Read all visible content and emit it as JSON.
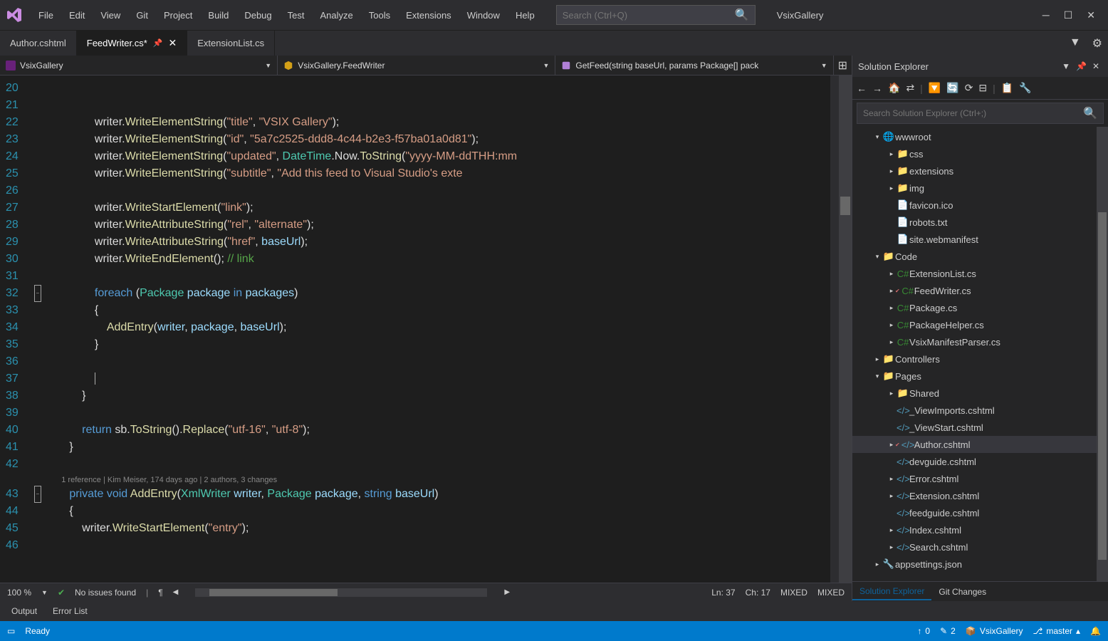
{
  "menu": [
    "File",
    "Edit",
    "View",
    "Git",
    "Project",
    "Build",
    "Debug",
    "Test",
    "Analyze",
    "Tools",
    "Extensions",
    "Window",
    "Help"
  ],
  "search_placeholder": "Search (Ctrl+Q)",
  "solution_name": "VsixGallery",
  "tabs": [
    {
      "label": "Author.cshtml",
      "active": false,
      "dirty": false
    },
    {
      "label": "FeedWriter.cs*",
      "active": true,
      "dirty": true
    },
    {
      "label": "ExtensionList.cs",
      "active": false,
      "dirty": false
    }
  ],
  "nav": {
    "dd1": "VsixGallery",
    "dd2": "VsixGallery.FeedWriter",
    "dd3": "GetFeed(string baseUrl, params Package[] pack"
  },
  "code": [
    {
      "n": 20,
      "frag": []
    },
    {
      "n": 21,
      "frag": []
    },
    {
      "n": 22,
      "frag": [
        [
          "txt",
          "                writer."
        ],
        [
          "fn",
          "WriteElementString"
        ],
        [
          "txt",
          "("
        ],
        [
          "str",
          "\"title\""
        ],
        [
          "txt",
          ", "
        ],
        [
          "str",
          "\"VSIX Gallery\""
        ],
        [
          "txt",
          ");"
        ]
      ]
    },
    {
      "n": 23,
      "frag": [
        [
          "txt",
          "                writer."
        ],
        [
          "fn",
          "WriteElementString"
        ],
        [
          "txt",
          "("
        ],
        [
          "str",
          "\"id\""
        ],
        [
          "txt",
          ", "
        ],
        [
          "str",
          "\"5a7c2525-ddd8-4c44-b2e3-f57ba01a0d81\""
        ],
        [
          "txt",
          ");"
        ]
      ]
    },
    {
      "n": 24,
      "frag": [
        [
          "txt",
          "                writer."
        ],
        [
          "fn",
          "WriteElementString"
        ],
        [
          "txt",
          "("
        ],
        [
          "str",
          "\"updated\""
        ],
        [
          "txt",
          ", "
        ],
        [
          "type",
          "DateTime"
        ],
        [
          "txt",
          ".Now."
        ],
        [
          "fn",
          "ToString"
        ],
        [
          "txt",
          "("
        ],
        [
          "str",
          "\"yyyy-MM-ddTHH:mm"
        ]
      ]
    },
    {
      "n": 25,
      "frag": [
        [
          "txt",
          "                writer."
        ],
        [
          "fn",
          "WriteElementString"
        ],
        [
          "txt",
          "("
        ],
        [
          "str",
          "\"subtitle\""
        ],
        [
          "txt",
          ", "
        ],
        [
          "str",
          "\"Add this feed to Visual Studio's exte"
        ]
      ]
    },
    {
      "n": 26,
      "frag": []
    },
    {
      "n": 27,
      "frag": [
        [
          "txt",
          "                writer."
        ],
        [
          "fn",
          "WriteStartElement"
        ],
        [
          "txt",
          "("
        ],
        [
          "str",
          "\"link\""
        ],
        [
          "txt",
          ");"
        ]
      ]
    },
    {
      "n": 28,
      "frag": [
        [
          "txt",
          "                writer."
        ],
        [
          "fn",
          "WriteAttributeString"
        ],
        [
          "txt",
          "("
        ],
        [
          "str",
          "\"rel\""
        ],
        [
          "txt",
          ", "
        ],
        [
          "str",
          "\"alternate\""
        ],
        [
          "txt",
          ");"
        ]
      ]
    },
    {
      "n": 29,
      "frag": [
        [
          "txt",
          "                writer."
        ],
        [
          "fn",
          "WriteAttributeString"
        ],
        [
          "txt",
          "("
        ],
        [
          "str",
          "\"href\""
        ],
        [
          "txt",
          ", "
        ],
        [
          "var",
          "baseUrl"
        ],
        [
          "txt",
          ");"
        ]
      ]
    },
    {
      "n": 30,
      "frag": [
        [
          "txt",
          "                writer."
        ],
        [
          "fn",
          "WriteEndElement"
        ],
        [
          "txt",
          "(); "
        ],
        [
          "cmt",
          "// link"
        ]
      ]
    },
    {
      "n": 31,
      "frag": []
    },
    {
      "n": 32,
      "frag": [
        [
          "txt",
          "                "
        ],
        [
          "kw",
          "foreach"
        ],
        [
          "txt",
          " ("
        ],
        [
          "type",
          "Package"
        ],
        [
          "txt",
          " "
        ],
        [
          "var",
          "package"
        ],
        [
          "txt",
          " "
        ],
        [
          "kw",
          "in"
        ],
        [
          "txt",
          " "
        ],
        [
          "var",
          "packages"
        ],
        [
          "txt",
          ")"
        ]
      ],
      "fold": true
    },
    {
      "n": 33,
      "frag": [
        [
          "txt",
          "                {"
        ]
      ]
    },
    {
      "n": 34,
      "frag": [
        [
          "txt",
          "                    "
        ],
        [
          "fn",
          "AddEntry"
        ],
        [
          "txt",
          "("
        ],
        [
          "var",
          "writer"
        ],
        [
          "txt",
          ", "
        ],
        [
          "var",
          "package"
        ],
        [
          "txt",
          ", "
        ],
        [
          "var",
          "baseUrl"
        ],
        [
          "txt",
          ");"
        ]
      ]
    },
    {
      "n": 35,
      "frag": [
        [
          "txt",
          "                }"
        ]
      ]
    },
    {
      "n": 36,
      "frag": []
    },
    {
      "n": 37,
      "frag": [
        [
          "txt",
          "                "
        ]
      ],
      "cursor": true
    },
    {
      "n": 38,
      "frag": [
        [
          "txt",
          "            }"
        ]
      ]
    },
    {
      "n": 39,
      "frag": []
    },
    {
      "n": 40,
      "frag": [
        [
          "txt",
          "            "
        ],
        [
          "kw",
          "return"
        ],
        [
          "txt",
          " sb."
        ],
        [
          "fn",
          "ToString"
        ],
        [
          "txt",
          "()."
        ],
        [
          "fn",
          "Replace"
        ],
        [
          "txt",
          "("
        ],
        [
          "str",
          "\"utf-16\""
        ],
        [
          "txt",
          ", "
        ],
        [
          "str",
          "\"utf-8\""
        ],
        [
          "txt",
          ");"
        ]
      ]
    },
    {
      "n": 41,
      "frag": [
        [
          "txt",
          "        }"
        ]
      ]
    },
    {
      "n": 42,
      "frag": []
    },
    {
      "n": "lens",
      "frag": [
        [
          "lens",
          "        1 reference | Kim Meiser, 174 days ago | 2 authors, 3 changes"
        ]
      ]
    },
    {
      "n": 43,
      "frag": [
        [
          "txt",
          "        "
        ],
        [
          "kw",
          "private"
        ],
        [
          "txt",
          " "
        ],
        [
          "kw",
          "void"
        ],
        [
          "txt",
          " "
        ],
        [
          "fn",
          "AddEntry"
        ],
        [
          "txt",
          "("
        ],
        [
          "type",
          "XmlWriter"
        ],
        [
          "txt",
          " "
        ],
        [
          "var",
          "writer"
        ],
        [
          "txt",
          ", "
        ],
        [
          "type",
          "Package"
        ],
        [
          "txt",
          " "
        ],
        [
          "var",
          "package"
        ],
        [
          "txt",
          ", "
        ],
        [
          "kw",
          "string"
        ],
        [
          "txt",
          " "
        ],
        [
          "var",
          "baseUrl"
        ],
        [
          "txt",
          ")"
        ]
      ],
      "fold": true
    },
    {
      "n": 44,
      "frag": [
        [
          "txt",
          "        {"
        ]
      ]
    },
    {
      "n": 45,
      "frag": [
        [
          "txt",
          "            writer."
        ],
        [
          "fn",
          "WriteStartElement"
        ],
        [
          "txt",
          "("
        ],
        [
          "str",
          "\"entry\""
        ],
        [
          "txt",
          ");"
        ]
      ]
    },
    {
      "n": 46,
      "frag": []
    }
  ],
  "editor_status": {
    "zoom": "100 %",
    "issues": "No issues found",
    "pos": "Ln: 37",
    "col": "Ch: 17",
    "ins1": "MIXED",
    "ins2": "MIXED"
  },
  "sol": {
    "title": "Solution Explorer",
    "search_placeholder": "Search Solution Explorer (Ctrl+;)",
    "tree": [
      {
        "ind": 28,
        "exp": "▾",
        "ic": "🌐",
        "cls": "globe-ic",
        "lbl": "wwwroot"
      },
      {
        "ind": 48,
        "exp": "▸",
        "ic": "📁",
        "cls": "folder-ic",
        "lbl": "css"
      },
      {
        "ind": 48,
        "exp": "▸",
        "ic": "📁",
        "cls": "folder-ic",
        "lbl": "extensions"
      },
      {
        "ind": 48,
        "exp": "▸",
        "ic": "📁",
        "cls": "folder-ic",
        "lbl": "img"
      },
      {
        "ind": 48,
        "exp": "",
        "ic": "📄",
        "cls": "",
        "lbl": "favicon.ico"
      },
      {
        "ind": 48,
        "exp": "",
        "ic": "📄",
        "cls": "",
        "lbl": "robots.txt"
      },
      {
        "ind": 48,
        "exp": "",
        "ic": "📄",
        "cls": "",
        "lbl": "site.webmanifest"
      },
      {
        "ind": 28,
        "exp": "▾",
        "ic": "📁",
        "cls": "folder-ic",
        "lbl": "Code"
      },
      {
        "ind": 48,
        "exp": "▸",
        "ic": "C#",
        "cls": "cs-ic",
        "lbl": "ExtensionList.cs"
      },
      {
        "ind": 48,
        "exp": "▸",
        "ic": "C#",
        "cls": "cs-ic",
        "lbl": "FeedWriter.cs",
        "check": true
      },
      {
        "ind": 48,
        "exp": "▸",
        "ic": "C#",
        "cls": "cs-ic",
        "lbl": "Package.cs"
      },
      {
        "ind": 48,
        "exp": "▸",
        "ic": "C#",
        "cls": "cs-ic",
        "lbl": "PackageHelper.cs"
      },
      {
        "ind": 48,
        "exp": "▸",
        "ic": "C#",
        "cls": "cs-ic",
        "lbl": "VsixManifestParser.cs"
      },
      {
        "ind": 28,
        "exp": "▸",
        "ic": "📁",
        "cls": "folder-ic",
        "lbl": "Controllers"
      },
      {
        "ind": 28,
        "exp": "▾",
        "ic": "📁",
        "cls": "folder-ic",
        "lbl": "Pages"
      },
      {
        "ind": 48,
        "exp": "▸",
        "ic": "📁",
        "cls": "folder-ic",
        "lbl": "Shared"
      },
      {
        "ind": 48,
        "exp": "",
        "ic": "</>",
        "cls": "html-ic",
        "lbl": "_ViewImports.cshtml"
      },
      {
        "ind": 48,
        "exp": "",
        "ic": "</>",
        "cls": "html-ic",
        "lbl": "_ViewStart.cshtml"
      },
      {
        "ind": 48,
        "exp": "▸",
        "ic": "</>",
        "cls": "html-ic",
        "lbl": "Author.cshtml",
        "sel": true,
        "check": true
      },
      {
        "ind": 48,
        "exp": "",
        "ic": "</>",
        "cls": "html-ic",
        "lbl": "devguide.cshtml"
      },
      {
        "ind": 48,
        "exp": "▸",
        "ic": "</>",
        "cls": "html-ic",
        "lbl": "Error.cshtml"
      },
      {
        "ind": 48,
        "exp": "▸",
        "ic": "</>",
        "cls": "html-ic",
        "lbl": "Extension.cshtml"
      },
      {
        "ind": 48,
        "exp": "",
        "ic": "</>",
        "cls": "html-ic",
        "lbl": "feedguide.cshtml"
      },
      {
        "ind": 48,
        "exp": "▸",
        "ic": "</>",
        "cls": "html-ic",
        "lbl": "Index.cshtml"
      },
      {
        "ind": 48,
        "exp": "▸",
        "ic": "</>",
        "cls": "html-ic",
        "lbl": "Search.cshtml"
      },
      {
        "ind": 28,
        "exp": "▸",
        "ic": "🔧",
        "cls": "",
        "lbl": "appsettings.json"
      }
    ],
    "tabs": [
      "Solution Explorer",
      "Git Changes"
    ]
  },
  "out_tabs": [
    "Output",
    "Error List"
  ],
  "status": {
    "ready": "Ready",
    "err_count": "0",
    "pen_count": "2",
    "repo": "VsixGallery",
    "branch": "master"
  }
}
